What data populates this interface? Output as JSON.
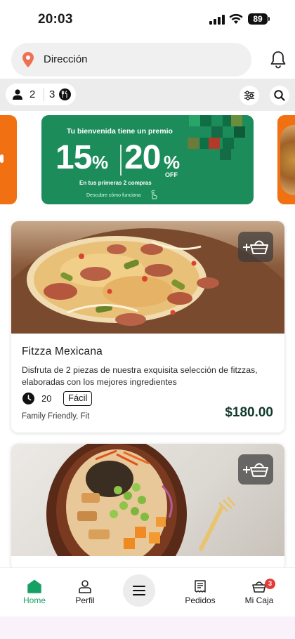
{
  "status": {
    "time": "20:03",
    "battery": "89"
  },
  "header": {
    "address_placeholder": "Dirección"
  },
  "filters": {
    "adults": "2",
    "kids": "3"
  },
  "promo": {
    "title": "Tu bienvenida tiene un premio",
    "first_discount": "15",
    "second_discount": "20",
    "percent_sign": "%",
    "off_label": "OFF",
    "subtitle": "En tus primeras 2 compras",
    "link": "Descubre cómo funciona",
    "color": "#1c8c5a"
  },
  "products": [
    {
      "title": "Fitzza Mexicana",
      "description": "Disfruta de 2 piezas de nuestra exquisita selección de fitzzas, elaboradas con los mejores ingredientes",
      "time": "20",
      "level": "Fácil",
      "tags": "Family Friendly, Fit",
      "price": "$180.00"
    }
  ],
  "nav": {
    "home": "Home",
    "profile": "Perfil",
    "orders": "Pedidos",
    "box": "Mi Caja",
    "box_count": "3",
    "active_color": "#16a064"
  }
}
